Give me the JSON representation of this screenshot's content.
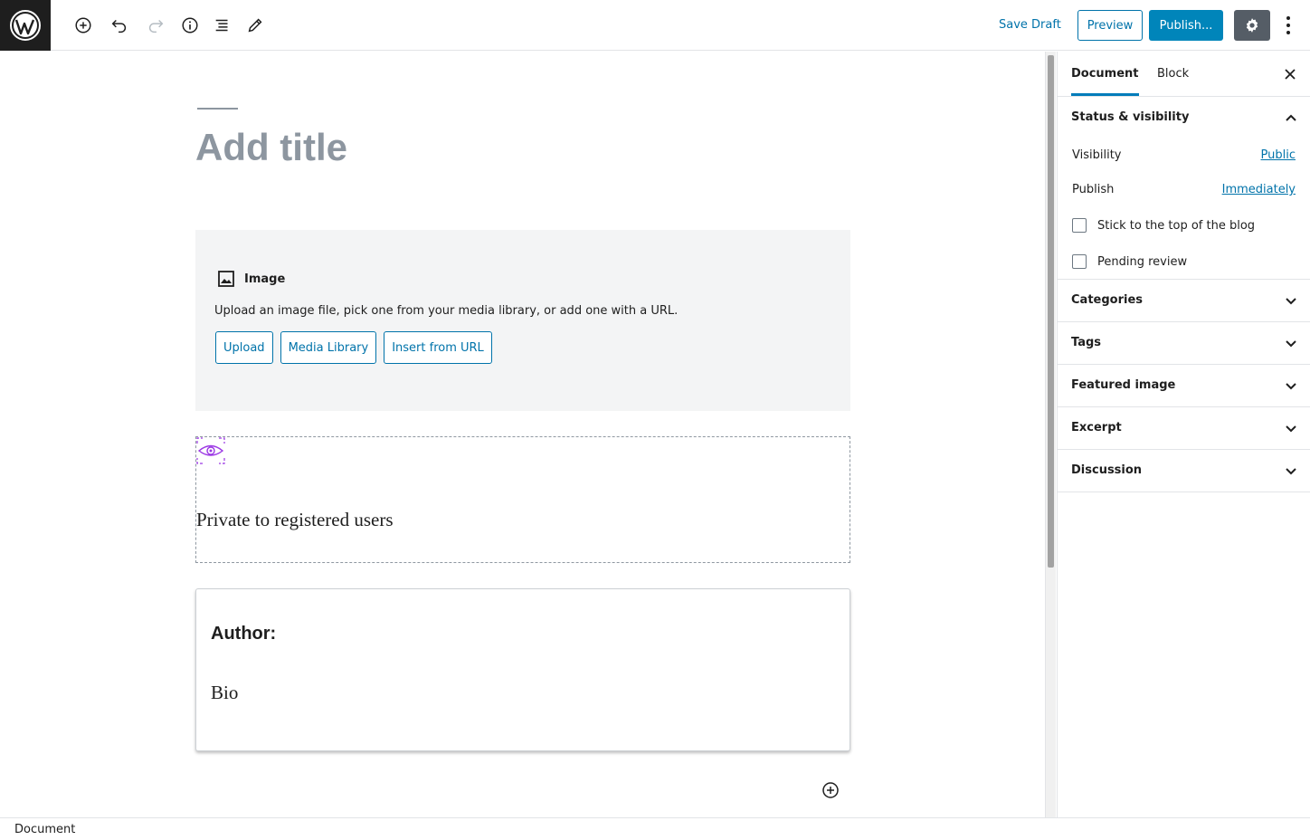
{
  "toolbar": {
    "logo_icon": "wordpress-logo",
    "tools": [
      "add-block-icon",
      "undo-icon",
      "redo-icon",
      "info-icon",
      "list-view-icon",
      "edit-icon"
    ],
    "save_draft": "Save Draft",
    "preview": "Preview",
    "publish": "Publish..."
  },
  "editor": {
    "title_placeholder": "Add title",
    "image_block": {
      "label": "Image",
      "description": "Upload an image file, pick one from your media library, or add one with a URL.",
      "buttons": [
        "Upload",
        "Media Library",
        "Insert from URL"
      ]
    },
    "private_block": {
      "text": "Private to registered users",
      "icon": "eye-icon",
      "accent": "#9b37e4"
    },
    "author_card": {
      "label": "Author:",
      "bio": "Bio"
    }
  },
  "sidebar": {
    "tabs": [
      "Document",
      "Block"
    ],
    "active_tab": "Document",
    "status": {
      "title": "Status & visibility",
      "visibility_label": "Visibility",
      "visibility_value": "Public",
      "publish_label": "Publish",
      "publish_value": "Immediately",
      "sticky_label": "Stick to the top of the blog",
      "pending_label": "Pending review"
    },
    "panels": [
      "Categories",
      "Tags",
      "Featured image",
      "Excerpt",
      "Discussion"
    ]
  },
  "footer": {
    "breadcrumb": "Document"
  },
  "colors": {
    "accent": "#0085ba",
    "link": "#0073aa"
  }
}
